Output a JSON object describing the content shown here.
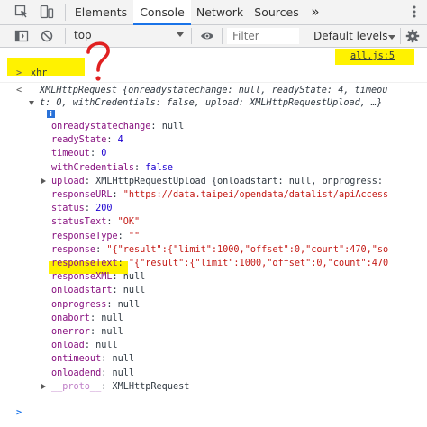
{
  "tabs": [
    {
      "label": "Elements",
      "active": false
    },
    {
      "label": "Console",
      "active": true
    },
    {
      "label": "Network",
      "active": false
    },
    {
      "label": "Sources",
      "active": false
    }
  ],
  "more_tabs_glyph": "»",
  "toolbar": {
    "context": "top",
    "filter_placeholder": "Filter",
    "levels_label": "Default levels"
  },
  "console": {
    "source_link": "all.js:5",
    "input_echo_prompt": ">",
    "input_echo": "xhr",
    "result_prompt": "<",
    "summary_line1": "XMLHttpRequest {onreadystatechange: null, readyState: 4, timeou",
    "summary_line2": "t: 0, withCredentials: false, upload: XMLHttpRequestUpload, …}",
    "info_badge": "i",
    "properties": [
      {
        "key": "onreadystatechange",
        "value": "null",
        "type": "plain"
      },
      {
        "key": "readyState",
        "value": "4",
        "type": "number"
      },
      {
        "key": "timeout",
        "value": "0",
        "type": "number"
      },
      {
        "key": "withCredentials",
        "value": "false",
        "type": "number"
      },
      {
        "key": "upload",
        "value": "XMLHttpRequestUpload {onloadstart: null, onprogress: ",
        "type": "plain",
        "expandable": true
      },
      {
        "key": "responseURL",
        "value": "\"https://data.taipei/opendata/datalist/apiAccess",
        "type": "string"
      },
      {
        "key": "status",
        "value": "200",
        "type": "number"
      },
      {
        "key": "statusText",
        "value": "\"OK\"",
        "type": "string"
      },
      {
        "key": "responseType",
        "value": "\"\"",
        "type": "string"
      },
      {
        "key": "response",
        "value": "\"{\"result\":{\"limit\":1000,\"offset\":0,\"count\":470,\"so",
        "type": "string"
      },
      {
        "key": "responseText",
        "value": "\"{\"result\":{\"limit\":1000,\"offset\":0,\"count\":470",
        "type": "string"
      },
      {
        "key": "responseXML",
        "value": "null",
        "type": "plain"
      },
      {
        "key": "onloadstart",
        "value": "null",
        "type": "plain"
      },
      {
        "key": "onprogress",
        "value": "null",
        "type": "plain"
      },
      {
        "key": "onabort",
        "value": "null",
        "type": "plain"
      },
      {
        "key": "onerror",
        "value": "null",
        "type": "plain"
      },
      {
        "key": "onload",
        "value": "null",
        "type": "plain"
      },
      {
        "key": "ontimeout",
        "value": "null",
        "type": "plain"
      },
      {
        "key": "onloadend",
        "value": "null",
        "type": "plain"
      },
      {
        "key": "__proto__",
        "value": "XMLHttpRequest",
        "type": "plain",
        "expandable": true,
        "dim": true
      }
    ],
    "prompt": ">"
  },
  "colors": {
    "highlight": "#fff200",
    "annotation_red": "#e02020",
    "key": "#881280",
    "number": "#1c00cf",
    "string": "#c41a16",
    "prompt_blue": "#1a73e8"
  }
}
